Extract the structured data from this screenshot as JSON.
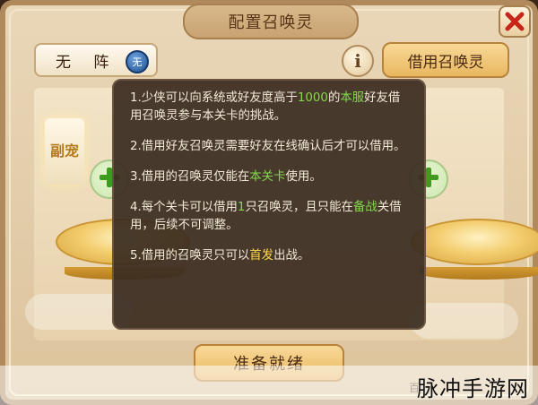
{
  "dialog": {
    "title": "配置召唤灵",
    "close_icon": "close-icon"
  },
  "toolbar": {
    "formation_label": "无 阵",
    "formation_badge": "无",
    "info_label": "i",
    "borrow_label": "借用召唤灵"
  },
  "slot": {
    "side_plaque": "副宠"
  },
  "tooltip": {
    "items": [
      {
        "a": "1.少侠可以向系统或好友度高于",
        "b": "1000",
        "c": "的",
        "d": "本服",
        "e": "好友借用召唤灵参与本关卡的挑战。"
      },
      {
        "a": "2.借用好友召唤灵需要好友在线确认后才可以借用。"
      },
      {
        "a": "3.借用的召唤灵仅能在",
        "b": "本关卡",
        "c": "使用。"
      },
      {
        "a": "4.每个关卡可以借用",
        "b": "1",
        "c": "只召唤灵，且只能在",
        "d": "备战",
        "e": "关借用，后续不可调整。"
      },
      {
        "a": "5.借用的召唤灵只可以",
        "b": "首发",
        "c": "出战。"
      }
    ]
  },
  "footer": {
    "ready_label": "准备就绪"
  },
  "watermark": {
    "text": "脉冲手游网",
    "faint": "百"
  },
  "colors": {
    "highlight_green": "#85d84d",
    "highlight_yellow": "#ffd84b",
    "tooltip_bg": "#3a2c20"
  }
}
